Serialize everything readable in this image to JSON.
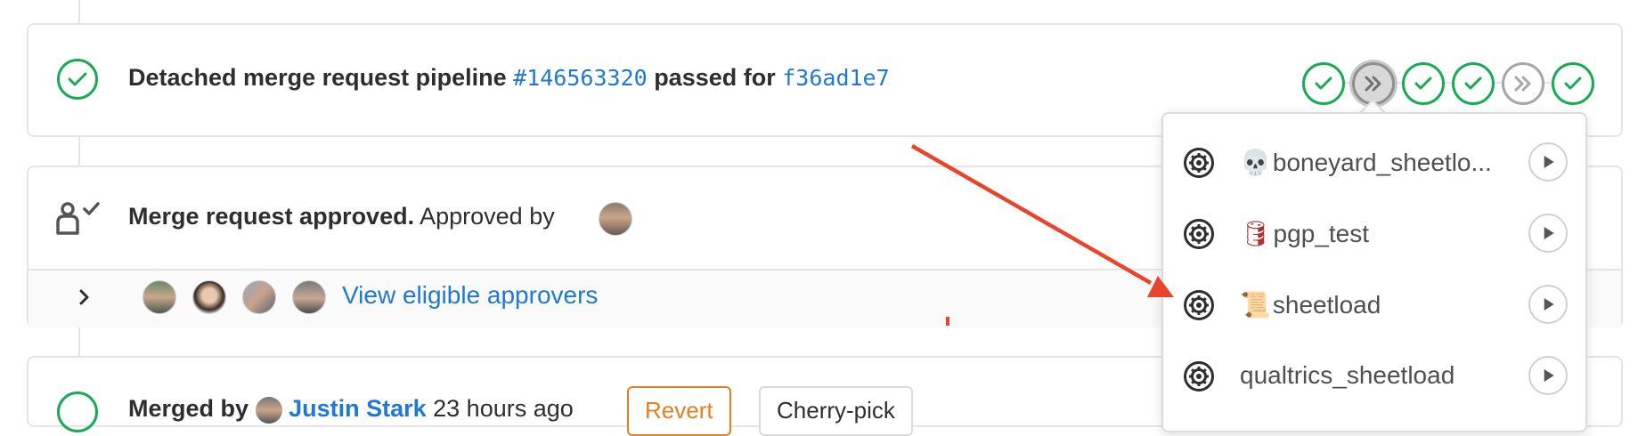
{
  "pipeline": {
    "prefix": "Detached merge request pipeline",
    "pipeline_id": "#146563320",
    "middle": "passed for",
    "commit": "f36ad1e7",
    "stages": [
      {
        "status": "success",
        "icon": "check-icon"
      },
      {
        "status": "skipped",
        "icon": "double-chevron-icon",
        "active": true
      },
      {
        "status": "success",
        "icon": "check-icon"
      },
      {
        "status": "success",
        "icon": "check-icon"
      },
      {
        "status": "skipped",
        "icon": "double-chevron-icon"
      },
      {
        "status": "success",
        "icon": "check-icon"
      }
    ]
  },
  "approval": {
    "bold": "Merge request approved.",
    "rest": "Approved by",
    "view_approvers": "View eligible approvers"
  },
  "merged": {
    "prefix": "Merged by",
    "user": "Justin Stark",
    "time": "23 hours ago",
    "revert_label": "Revert",
    "cherry_pick_label": "Cherry-pick"
  },
  "dropdown": {
    "items": [
      {
        "emoji": "💀",
        "label": "boneyard_sheetlo..."
      },
      {
        "emoji": "🛢",
        "label": "pgp_test"
      },
      {
        "emoji": "📜",
        "label": "sheetload"
      },
      {
        "emoji": "",
        "label": "qualtrics_sheetload"
      }
    ]
  },
  "colors": {
    "success": "#1aaa55",
    "link": "#1f78d1",
    "revert": "#e67e22",
    "arrow": "#e8452c"
  }
}
